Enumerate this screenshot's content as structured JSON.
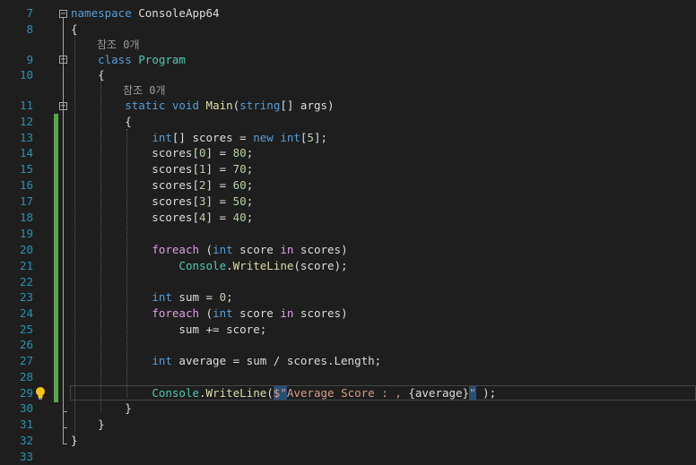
{
  "editor": {
    "lines": [
      {
        "num": "7",
        "code": [
          {
            "t": "namespace",
            "c": "kw"
          },
          {
            "t": " ConsoleApp64",
            "c": "tx"
          }
        ]
      },
      {
        "num": "8",
        "code": [
          {
            "t": "{",
            "c": "tx"
          }
        ]
      },
      {
        "lens": "참조 0개"
      },
      {
        "num": "9",
        "code": [
          {
            "t": "    ",
            "c": "tx"
          },
          {
            "t": "class",
            "c": "kw"
          },
          {
            "t": " ",
            "c": "tx"
          },
          {
            "t": "Program",
            "c": "ty"
          }
        ]
      },
      {
        "num": "10",
        "code": [
          {
            "t": "    {",
            "c": "tx"
          }
        ]
      },
      {
        "lens": "참조 0개"
      },
      {
        "num": "11",
        "code": [
          {
            "t": "        ",
            "c": "tx"
          },
          {
            "t": "static",
            "c": "kw"
          },
          {
            "t": " ",
            "c": "tx"
          },
          {
            "t": "void",
            "c": "kw"
          },
          {
            "t": " ",
            "c": "tx"
          },
          {
            "t": "Main",
            "c": "fn"
          },
          {
            "t": "(",
            "c": "tx"
          },
          {
            "t": "string",
            "c": "kw"
          },
          {
            "t": "[] args)",
            "c": "tx"
          }
        ]
      },
      {
        "num": "12",
        "code": [
          {
            "t": "        {",
            "c": "tx"
          }
        ]
      },
      {
        "num": "13",
        "code": [
          {
            "t": "            ",
            "c": "tx"
          },
          {
            "t": "int",
            "c": "kw"
          },
          {
            "t": "[] scores = ",
            "c": "tx"
          },
          {
            "t": "new",
            "c": "kw"
          },
          {
            "t": " ",
            "c": "tx"
          },
          {
            "t": "int",
            "c": "kw"
          },
          {
            "t": "[",
            "c": "tx"
          },
          {
            "t": "5",
            "c": "num"
          },
          {
            "t": "];",
            "c": "tx"
          }
        ]
      },
      {
        "num": "14",
        "code": [
          {
            "t": "            scores[",
            "c": "tx"
          },
          {
            "t": "0",
            "c": "num"
          },
          {
            "t": "] = ",
            "c": "tx"
          },
          {
            "t": "80",
            "c": "num"
          },
          {
            "t": ";",
            "c": "tx"
          }
        ]
      },
      {
        "num": "15",
        "code": [
          {
            "t": "            scores[",
            "c": "tx"
          },
          {
            "t": "1",
            "c": "num"
          },
          {
            "t": "] = ",
            "c": "tx"
          },
          {
            "t": "70",
            "c": "num"
          },
          {
            "t": ";",
            "c": "tx"
          }
        ]
      },
      {
        "num": "16",
        "code": [
          {
            "t": "            scores[",
            "c": "tx"
          },
          {
            "t": "2",
            "c": "num"
          },
          {
            "t": "] = ",
            "c": "tx"
          },
          {
            "t": "60",
            "c": "num"
          },
          {
            "t": ";",
            "c": "tx"
          }
        ]
      },
      {
        "num": "17",
        "code": [
          {
            "t": "            scores[",
            "c": "tx"
          },
          {
            "t": "3",
            "c": "num"
          },
          {
            "t": "] = ",
            "c": "tx"
          },
          {
            "t": "50",
            "c": "num"
          },
          {
            "t": ";",
            "c": "tx"
          }
        ]
      },
      {
        "num": "18",
        "code": [
          {
            "t": "            scores[",
            "c": "tx"
          },
          {
            "t": "4",
            "c": "num"
          },
          {
            "t": "] = ",
            "c": "tx"
          },
          {
            "t": "40",
            "c": "num"
          },
          {
            "t": ";",
            "c": "tx"
          }
        ]
      },
      {
        "num": "19",
        "code": []
      },
      {
        "num": "20",
        "code": [
          {
            "t": "            ",
            "c": "tx"
          },
          {
            "t": "foreach",
            "c": "ctl"
          },
          {
            "t": " (",
            "c": "tx"
          },
          {
            "t": "int",
            "c": "kw"
          },
          {
            "t": " score ",
            "c": "tx"
          },
          {
            "t": "in",
            "c": "ctl"
          },
          {
            "t": " scores)",
            "c": "tx"
          }
        ]
      },
      {
        "num": "21",
        "code": [
          {
            "t": "                ",
            "c": "tx"
          },
          {
            "t": "Console",
            "c": "ty"
          },
          {
            "t": ".",
            "c": "tx"
          },
          {
            "t": "WriteLine",
            "c": "fn"
          },
          {
            "t": "(score);",
            "c": "tx"
          }
        ]
      },
      {
        "num": "22",
        "code": []
      },
      {
        "num": "23",
        "code": [
          {
            "t": "            ",
            "c": "tx"
          },
          {
            "t": "int",
            "c": "kw"
          },
          {
            "t": " sum = ",
            "c": "tx"
          },
          {
            "t": "0",
            "c": "num"
          },
          {
            "t": ";",
            "c": "tx"
          }
        ]
      },
      {
        "num": "24",
        "code": [
          {
            "t": "            ",
            "c": "tx"
          },
          {
            "t": "foreach",
            "c": "ctl"
          },
          {
            "t": " (",
            "c": "tx"
          },
          {
            "t": "int",
            "c": "kw"
          },
          {
            "t": " score ",
            "c": "tx"
          },
          {
            "t": "in",
            "c": "ctl"
          },
          {
            "t": " scores)",
            "c": "tx"
          }
        ]
      },
      {
        "num": "25",
        "code": [
          {
            "t": "                sum += score;",
            "c": "tx"
          }
        ]
      },
      {
        "num": "26",
        "code": []
      },
      {
        "num": "27",
        "code": [
          {
            "t": "            ",
            "c": "tx"
          },
          {
            "t": "int",
            "c": "kw"
          },
          {
            "t": " average = sum / scores.Length;",
            "c": "tx"
          }
        ]
      },
      {
        "num": "28",
        "code": []
      },
      {
        "num": "29",
        "code": [
          {
            "t": "            ",
            "c": "tx"
          },
          {
            "t": "Console",
            "c": "ty"
          },
          {
            "t": ".",
            "c": "tx"
          },
          {
            "t": "WriteLine",
            "c": "fn"
          },
          {
            "t": "(",
            "c": "tx"
          },
          {
            "t": "$\"",
            "c": "str hl"
          },
          {
            "t": "Average Score : , ",
            "c": "str"
          },
          {
            "t": "{average}",
            "c": "tx"
          },
          {
            "t": "\"",
            "c": "str hl"
          },
          {
            "t": " );",
            "c": "tx"
          }
        ]
      },
      {
        "num": "30",
        "code": [
          {
            "t": "        }",
            "c": "tx"
          }
        ]
      },
      {
        "num": "31",
        "code": [
          {
            "t": "    }",
            "c": "tx"
          }
        ]
      },
      {
        "num": "32",
        "code": [
          {
            "t": "}",
            "c": "tx"
          }
        ]
      },
      {
        "num": "33",
        "code": []
      }
    ]
  },
  "colors": {
    "background": "#1e1e1e",
    "keyword": "#569cd6",
    "type": "#4ec9b0",
    "method": "#dcdcaa",
    "control": "#d8a0df",
    "string": "#d69d85",
    "number": "#b5cea8",
    "line_number": "#2b91af",
    "change_bar": "#57a64a"
  },
  "icons": {
    "quick_action": "lightbulb-icon",
    "fold": "collapse-minus-icon"
  }
}
